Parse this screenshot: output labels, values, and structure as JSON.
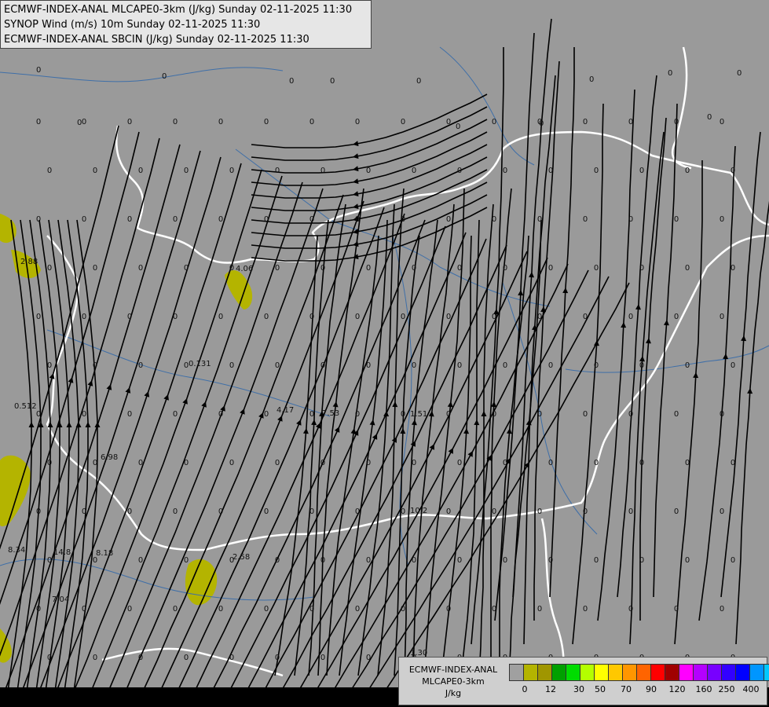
{
  "header": {
    "line1": "ECMWF-INDEX-ANAL MLCAPE0-3km (J/kg) Sunday 02-11-2025 11:30",
    "line2": "SYNOP Wind (m/s) 10m Sunday 02-11-2025 11:30",
    "line3": "ECMWF-INDEX-ANAL SBCIN (J/kg) Sunday 02-11-2025 11:30"
  },
  "legend": {
    "title_line1": "ECMWF-INDEX-ANAL",
    "title_line2": "MLCAPE0-3km",
    "title_line3": "J/kg",
    "colors": [
      "#a0a0a0",
      "#b4b400",
      "#a09600",
      "#00a000",
      "#00dc00",
      "#b4ff00",
      "#ffff00",
      "#ffc800",
      "#ff9600",
      "#ff6400",
      "#ff0000",
      "#a00000",
      "#ff00ff",
      "#b400ff",
      "#7800ff",
      "#3200ff",
      "#0000ff",
      "#0096ff",
      "#00c8ff",
      "#64ffff",
      "#ffffff"
    ],
    "ticks": [
      "0",
      "12",
      "30",
      "50",
      "70",
      "90",
      "120",
      "160",
      "250",
      "400"
    ]
  },
  "map": {
    "cape_labels": [
      {
        "text": "0"
      },
      {
        "text": "0"
      },
      {
        "text": "0"
      },
      {
        "text": "0"
      },
      {
        "text": "0"
      },
      {
        "text": "0"
      },
      {
        "text": "0"
      },
      {
        "text": "0"
      },
      {
        "text": "0"
      },
      {
        "text": "0"
      },
      {
        "text": "0"
      },
      {
        "text": "0"
      },
      {
        "text": "2.88"
      },
      {
        "text": "4.06"
      },
      {
        "text": "0.131"
      },
      {
        "text": "0.512"
      },
      {
        "text": "4.17"
      },
      {
        "text": "7.53"
      },
      {
        "text": "1.51"
      },
      {
        "text": "6.98"
      },
      {
        "text": "8.34"
      },
      {
        "text": "14.8"
      },
      {
        "text": "8.18"
      },
      {
        "text": "2.58"
      },
      {
        "text": "7.04"
      },
      {
        "text": "10.2"
      },
      {
        "text": "1.30"
      }
    ]
  },
  "colors": {
    "background": "#9a9a9a",
    "border": "#ffffff",
    "river": "#3f6fa8",
    "streamline": "#000000",
    "cape_fill": "#b4b400"
  }
}
